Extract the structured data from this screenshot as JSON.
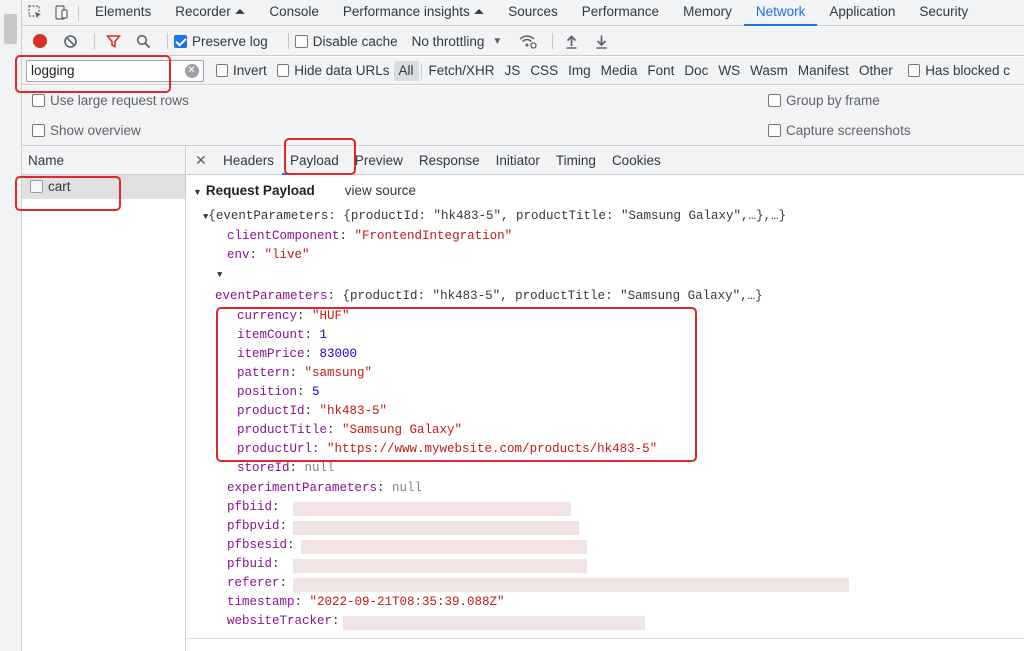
{
  "devtools": {
    "tabs": [
      "Elements",
      "Recorder ⏶",
      "Console",
      "Performance insights ⏶",
      "Sources",
      "Performance",
      "Memory",
      "Network",
      "Application",
      "Security"
    ],
    "active_tab": "Network"
  },
  "toolbar": {
    "preserve_log": "Preserve log",
    "disable_cache": "Disable cache",
    "throttling": "No throttling"
  },
  "filter": {
    "value": "logging",
    "invert": "Invert",
    "hide_data_urls": "Hide data URLs",
    "types": [
      "All",
      "Fetch/XHR",
      "JS",
      "CSS",
      "Img",
      "Media",
      "Font",
      "Doc",
      "WS",
      "Wasm",
      "Manifest",
      "Other"
    ],
    "has_blocked": "Has blocked c"
  },
  "options": {
    "large_rows": "Use large request rows",
    "group_by_frame": "Group by frame",
    "show_overview": "Show overview",
    "capture_screenshots": "Capture screenshots"
  },
  "requests": {
    "header": "Name",
    "rows": [
      "cart"
    ]
  },
  "detail": {
    "tabs": [
      "Headers",
      "Payload",
      "Preview",
      "Response",
      "Initiator",
      "Timing",
      "Cookies"
    ],
    "active_tab": "Payload"
  },
  "payload": {
    "section_title": "Request Payload",
    "view_source": "view source",
    "root_summary": "{eventParameters: {productId: \"hk483-5\", productTitle: \"Samsung Galaxy\",…},…}",
    "client_component_key": "clientComponent",
    "client_component_val": "\"FrontendIntegration\"",
    "env_key": "env",
    "env_val": "\"live\"",
    "event_params_key": "eventParameters",
    "event_params_summary": "{productId: \"hk483-5\", productTitle: \"Samsung Galaxy\",…}",
    "currency_key": "currency",
    "currency_val": "\"HUF\"",
    "item_count_key": "itemCount",
    "item_count_val": "1",
    "item_price_key": "itemPrice",
    "item_price_val": "83000",
    "pattern_key": "pattern",
    "pattern_val": "\"samsung\"",
    "position_key": "position",
    "position_val": "5",
    "product_id_key": "productId",
    "product_id_val": "\"hk483-5\"",
    "product_title_key": "productTitle",
    "product_title_val": "\"Samsung Galaxy\"",
    "product_url_key": "productUrl",
    "product_url_val": "\"https://www.mywebsite.com/products/hk483-5\"",
    "store_id_key": "storeId",
    "store_id_val": "null",
    "experiment_key": "experimentParameters",
    "experiment_val": "null",
    "pfbiid_key": "pfbiid",
    "pfbpvid_key": "pfbpvid",
    "pfbsesid_key": "pfbsesid",
    "pfbuid_key": "pfbuid",
    "referer_key": "referer",
    "timestamp_key": "timestamp",
    "timestamp_val": "\"2022-09-21T08:35:39.088Z\"",
    "website_tracker_key": "websiteTracker"
  },
  "colors": {
    "accent": "#1a73e8",
    "highlight": "#e3262e",
    "record": "#d93025"
  }
}
